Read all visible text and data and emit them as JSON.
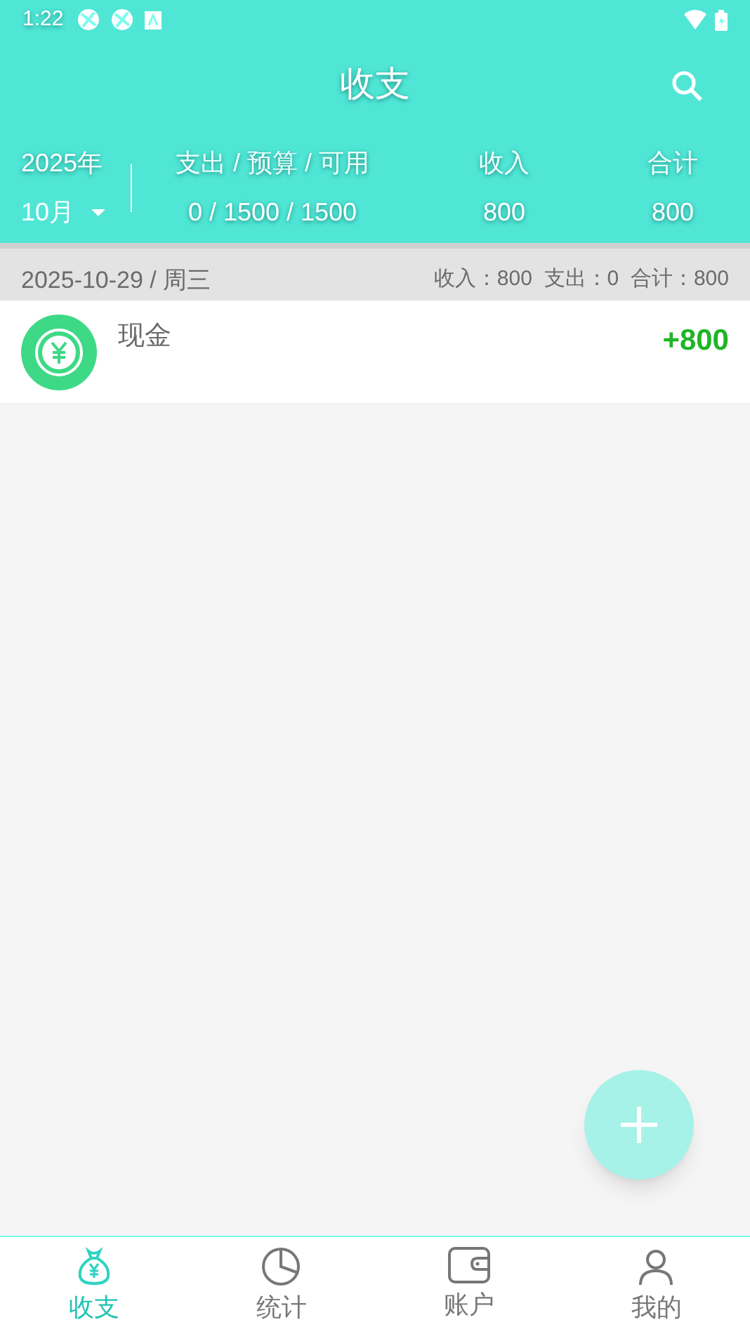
{
  "status_bar": {
    "time": "1:22"
  },
  "header": {
    "title": "收支",
    "year": "2025年",
    "month": "10月",
    "summary": [
      {
        "label": "支出 / 预算 / 可用",
        "value": "0 / 1500 / 1500"
      },
      {
        "label": "收入",
        "value": "800"
      },
      {
        "label": "合计",
        "value": "800"
      }
    ]
  },
  "days": [
    {
      "date": "2025-10-29 / 周三",
      "totals": "收入：800  支出：0  合计：800",
      "entries": [
        {
          "account": "现金",
          "amount": "+800",
          "kind": "income"
        }
      ]
    }
  ],
  "bottom_nav": [
    {
      "label": "收支",
      "kind": "moneybag",
      "selected": true
    },
    {
      "label": "统计",
      "kind": "pie",
      "selected": false
    },
    {
      "label": "账户",
      "kind": "wallet",
      "selected": false
    },
    {
      "label": "我的",
      "kind": "person",
      "selected": false
    }
  ]
}
